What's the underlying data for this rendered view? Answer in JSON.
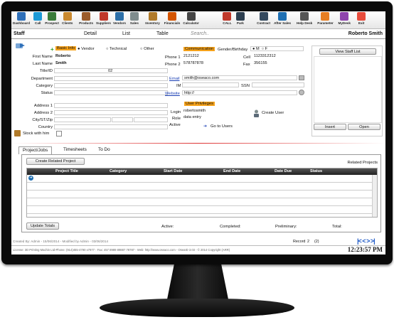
{
  "toolbar": {
    "items": [
      {
        "label": "Dashboard",
        "icon": "home-icon",
        "color": "#2e6fb8"
      },
      {
        "label": "Call",
        "icon": "phone-icon",
        "color": "#1d9ad6"
      },
      {
        "label": "Prospect",
        "icon": "person-icon",
        "color": "#3a7c3a"
      },
      {
        "label": "Clients",
        "icon": "clients-icon",
        "color": "#c9892f"
      },
      {
        "label": "Products",
        "icon": "box-icon",
        "color": "#9a5b2a"
      },
      {
        "label": "Suppliers",
        "icon": "truck-icon",
        "color": "#c0392b"
      },
      {
        "label": "Vendors",
        "icon": "vendors-icon",
        "color": "#2c6fa8"
      },
      {
        "label": "Sales",
        "icon": "sales-icon",
        "color": "#7f8c8d"
      },
      {
        "label": "Inventory",
        "icon": "inventory-icon",
        "color": "#b07a2a"
      },
      {
        "label": "Financials",
        "icon": "chart-icon",
        "color": "#d35400"
      },
      {
        "label": "Calculator",
        "icon": "calculator-icon",
        "color": "#444444"
      },
      {
        "label": "CALL",
        "icon": "call-person-icon",
        "color": "#c0392b"
      },
      {
        "label": "Park",
        "icon": "park-icon",
        "color": "#2c3e50"
      },
      {
        "label": "Contract",
        "icon": "contract-icon",
        "color": "#34495e"
      },
      {
        "label": "After Sales",
        "icon": "tools-icon",
        "color": "#1f6fb2"
      },
      {
        "label": "Help Desk",
        "icon": "help-desk-icon",
        "color": "#555555"
      },
      {
        "label": "Parameter",
        "icon": "parameter-icon",
        "color": "#e67e22"
      },
      {
        "label": "MyDesk",
        "icon": "mydesk-icon",
        "color": "#8e44ad"
      },
      {
        "label": "Exit",
        "icon": "power-icon",
        "color": "#e74c3c"
      }
    ]
  },
  "header": {
    "title": "Staff",
    "detail": "Detail",
    "list": "List",
    "table": "Table",
    "search_placeholder": "Search..",
    "user": "Roberto Smith"
  },
  "basic": {
    "section": "Basic Info",
    "vendor": "Vendor",
    "technical": "Technical",
    "other": "Other",
    "first_name_label": "First Name",
    "first_name": "Roberto",
    "last_name_label": "Last Name",
    "last_name": "Smith",
    "title_label": "Title/ID",
    "title_value": "02",
    "department_label": "Department",
    "category_label": "Category",
    "status_label": "Status"
  },
  "comm": {
    "section": "Communication",
    "gender_label": "Gender/Birthday",
    "male": "M",
    "female": "F",
    "phone1_label": "Phone 1",
    "phone1": "2121212",
    "phone2_label": "Phone 2",
    "phone2": "578787878",
    "cell_label": "Cell",
    "cell": "1123312312",
    "fax_label": "Fax",
    "fax": "356155",
    "email_label": "Email",
    "email": "smith@oseaco.com",
    "im_label": "IM",
    "ssn_label": "SSN",
    "website_label": "Website",
    "website": "http://"
  },
  "address": {
    "address1_label": "Address 1",
    "address2_label": "Address 2",
    "city_label": "City/ST/Zip",
    "country_label": "Country",
    "stock_label": "Stock with him"
  },
  "privileges": {
    "section": "User Privileges",
    "login_label": "Login",
    "login": "robertosmith",
    "role_label": "Role",
    "role": "data entry",
    "active_label": "Active",
    "goto_users": "Go to Users",
    "create_user": "Create User"
  },
  "staff_list": {
    "view_button": "View Staff List",
    "insert": "Insert",
    "open": "Open"
  },
  "tabs": [
    "Project/Jobs",
    "Timesheets",
    "To Do"
  ],
  "projects": {
    "create_button": "Create Related Project",
    "related_label": "Related Projects",
    "columns": [
      "Project Title",
      "Category",
      "Start Date",
      "End Date",
      "Date Due",
      "Status"
    ],
    "update_button": "Update Totals",
    "active_label": "Active:",
    "completed_label": "Completed:",
    "preliminary_label": "Preliminary:",
    "total_label": "Total:"
  },
  "footer": {
    "created": "Created By: Admin - 15/06/2014 - Modified by Admin - 03/06/2014",
    "record_label": "Record",
    "record": "2",
    "record_of": "(2)",
    "license": "License: 3D Printing Machin Ltd-Phone: (914)455-4790 x7977 - Fax: 457 8989 89887 78787 - Web: http://www.oseaco.com - OseaID 3.03 - © 2014 Copyright (ARR)",
    "clock": "12:23:57 PM"
  }
}
